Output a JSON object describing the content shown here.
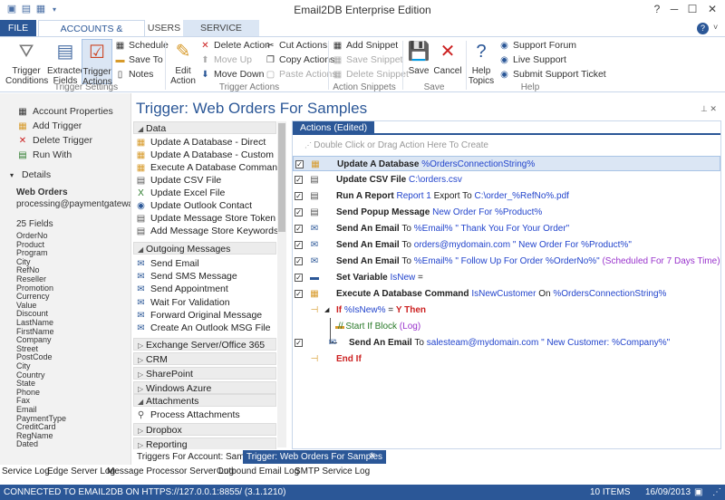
{
  "window": {
    "title": "Email2DB Enterprise Edition"
  },
  "colors": {
    "accent": "#2b5797",
    "selected_row": "#dbe6f4",
    "keyword": "#2244cc",
    "variable": "#9933cc"
  },
  "tabs": [
    "FILE",
    "ACCOUNTS & TRIGGERS",
    "USERS",
    "SERVICE STATUS"
  ],
  "ribbon": {
    "trigger_conditions": "Trigger\nConditions",
    "extracted_fields": "Extracted\nFields",
    "trigger_actions": "Trigger\nActions",
    "schedule": "Schedule",
    "save_to": "Save To",
    "notes": "Notes",
    "group_trigger_settings": "Trigger Settings",
    "edit_action": "Edit\nAction",
    "delete_action": "Delete Action",
    "move_up": "Move Up",
    "move_down": "Move Down",
    "cut_actions": "Cut Actions",
    "copy_actions": "Copy Actions",
    "paste_actions": "Paste Actions",
    "group_trigger_actions": "Trigger Actions",
    "add_snippet": "Add Snippet",
    "save_snippet": "Save Snippet",
    "delete_snippet": "Delete Snippet",
    "group_action_snippets": "Action Snippets",
    "save": "Save",
    "cancel": "Cancel",
    "group_save": "Save",
    "help_topics": "Help\nTopics",
    "support_forum": "Support Forum",
    "live_support": "Live Support",
    "submit_ticket": "Submit Support Ticket",
    "group_help": "Help"
  },
  "left": {
    "account_properties": "Account Properties",
    "add_trigger": "Add Trigger",
    "delete_trigger": "Delete Trigger",
    "run_with": "Run With",
    "details": "Details",
    "account_name": "Web Orders",
    "account_email": "processing@paymentgateway.com",
    "fields_count": "25 Fields",
    "fields": [
      "OrderNo",
      "Product",
      "Program",
      "City",
      "RefNo",
      "Reseller",
      "Promotion",
      "Currency",
      "Value",
      "Discount",
      "LastName",
      "FirstName",
      "Company",
      "Street",
      "PostCode",
      "City",
      "Country",
      "State",
      "Phone",
      "Fax",
      "Email",
      "PaymentType",
      "CreditCard",
      "RegName",
      "Dated"
    ]
  },
  "trigger_title": "Trigger: Web Orders For Samples",
  "palette": {
    "data_header": "Data",
    "data_items": [
      "Update A Database - Direct",
      "Update A Database - Custom",
      "Execute A Database Command",
      "Update CSV File",
      "Update Excel File",
      "Update Outlook Contact",
      "Update Message Store Token",
      "Add Message Store Keywords"
    ],
    "outgoing_header": "Outgoing Messages",
    "outgoing_items": [
      "Send Email",
      "Send SMS Message",
      "Send Appointment",
      "Wait For Validation",
      "Forward Original Message",
      "Create An Outlook MSG File"
    ],
    "exchange": "Exchange Server/Office 365",
    "crm": "CRM",
    "sharepoint": "SharePoint",
    "azure": "Windows Azure",
    "attachments": "Attachments",
    "process_attachments": "Process Attachments",
    "dropbox": "Dropbox",
    "reporting": "Reporting"
  },
  "actions": {
    "tab": "Actions (Edited)",
    "hint": "Double Click or Drag Action Here To Create",
    "rows": [
      {
        "parts": [
          [
            "kw",
            "Update A Database "
          ],
          [
            "bl",
            "%OrdersConnectionString%"
          ]
        ]
      },
      {
        "parts": [
          [
            "kw",
            "Update CSV File "
          ],
          [
            "bl",
            "C:\\orders.csv"
          ]
        ]
      },
      {
        "parts": [
          [
            "kw",
            "Run A Report "
          ],
          [
            "bl",
            "Report 1"
          ],
          [
            "kw2",
            " Export To "
          ],
          [
            "bl",
            "C:\\order_%RefNo%.pdf"
          ]
        ]
      },
      {
        "parts": [
          [
            "kw",
            "Send Popup Message "
          ],
          [
            "bl",
            "New Order For %Product%"
          ]
        ]
      },
      {
        "parts": [
          [
            "kw",
            "Send An Email "
          ],
          [
            "n",
            "To "
          ],
          [
            "bl",
            "%Email%"
          ],
          [
            "bl",
            " \" Thank You For Your Order\""
          ]
        ]
      },
      {
        "parts": [
          [
            "kw",
            "Send An Email "
          ],
          [
            "n",
            "To "
          ],
          [
            "bl",
            "orders@mydomain.com"
          ],
          [
            "bl",
            " \" New Order For %Product%\""
          ]
        ]
      },
      {
        "parts": [
          [
            "kw",
            "Send An Email "
          ],
          [
            "n",
            "To "
          ],
          [
            "bl",
            "%Email%"
          ],
          [
            "bl",
            " \" Follow Up For Order %OrderNo%\""
          ],
          [
            "pu",
            " (Scheduled For 7 Days Time)"
          ]
        ]
      },
      {
        "parts": [
          [
            "kw",
            "Set Variable "
          ],
          [
            "bl",
            "IsNew"
          ],
          [
            "n",
            " ="
          ]
        ]
      },
      {
        "parts": [
          [
            "kw",
            "Execute A Database Command "
          ],
          [
            "bl",
            "IsNewCustomer"
          ],
          [
            "n",
            " On "
          ],
          [
            "bl",
            "%OrdersConnectionString%"
          ]
        ]
      },
      {
        "parts": [
          [
            "rd",
            "If "
          ],
          [
            "bl",
            "%IsNew%"
          ],
          [
            "n",
            " = "
          ],
          [
            "rd",
            "Y "
          ],
          [
            "rd",
            " Then"
          ]
        ]
      },
      {
        "parts": [
          [
            "gr",
            "// Start If Block"
          ],
          [
            "pu",
            " (Log)"
          ]
        ]
      },
      {
        "parts": [
          [
            "kw",
            "Send An Email "
          ],
          [
            "n",
            "To "
          ],
          [
            "bl",
            "salesteam@mydomain.com"
          ],
          [
            "bl",
            " \" New Customer: %Company%\""
          ]
        ]
      },
      {
        "parts": [
          [
            "rd",
            "End If"
          ]
        ]
      }
    ]
  },
  "bottom_tabs": [
    "Triggers For Account: Samples",
    "Trigger: Web Orders For Samples"
  ],
  "logs": [
    "Service Log",
    "Edge Server Log",
    "Message Processor Server Log",
    "Outbound Email Log",
    "SMTP Service Log"
  ],
  "status": {
    "connection": "CONNECTED TO EMAIL2DB ON HTTPS://127.0.0.1:8855/ (3.1.1210)",
    "items": "10 ITEMS",
    "date": "16/09/2013"
  }
}
